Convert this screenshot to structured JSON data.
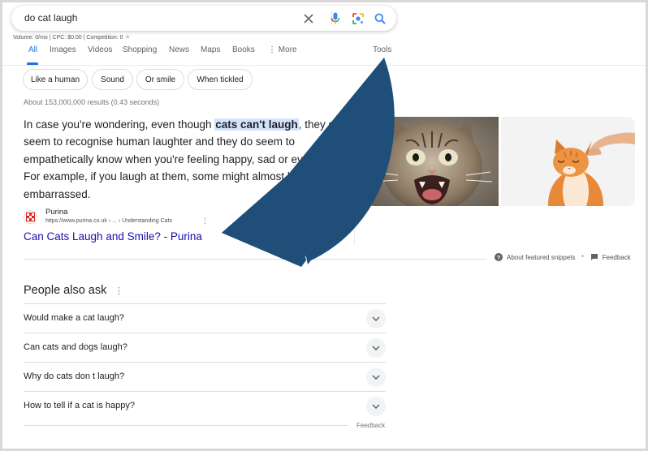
{
  "search": {
    "query": "do cat laugh",
    "volume_info": "Volume: 0/mo | CPC: $0.00 | Competition: 0"
  },
  "tabs": [
    {
      "label": "All",
      "active": true
    },
    {
      "label": "Images"
    },
    {
      "label": "Videos"
    },
    {
      "label": "Shopping"
    },
    {
      "label": "News"
    },
    {
      "label": "Maps"
    },
    {
      "label": "Books"
    },
    {
      "label": "More"
    },
    {
      "label": "Tools"
    }
  ],
  "chips": [
    "Like a human",
    "Sound",
    "Or smile",
    "When tickled"
  ],
  "result_stats": "About 153,000,000 results (0.43 seconds)",
  "snippet": {
    "before": "In case you're wondering, even though ",
    "highlight": "cats can't laugh",
    "after": ", they do seem to recognise human laughter and they do seem to empathetically know when you're feeling happy, sad or even sick. For example, if you laugh at them, some might almost look embarrassed."
  },
  "source": {
    "name": "Purina",
    "url": "https://www.purina.co.uk › ... › Understanding Cats",
    "title": "Can Cats Laugh and Smile? - Purina"
  },
  "snippet_footer": {
    "about": "About featured snippets",
    "separator": "•",
    "feedback": "Feedback"
  },
  "people_also_ask": {
    "title": "People also ask",
    "questions": [
      "Would make a cat laugh?",
      "Can cats and dogs laugh?",
      "Why do cats don t laugh?",
      "How to tell if a cat is happy?"
    ],
    "feedback": "Feedback"
  },
  "colors": {
    "link": "#1a0dab",
    "accent": "#1a73e8",
    "arrow": "#1f4e79",
    "highlight": "#d3e3fd"
  },
  "icons": [
    "close-icon",
    "microphone-icon",
    "lens-icon",
    "search-icon",
    "kebab-icon",
    "question-icon",
    "feedback-icon",
    "chevron-down-icon",
    "purina-logo-icon"
  ]
}
